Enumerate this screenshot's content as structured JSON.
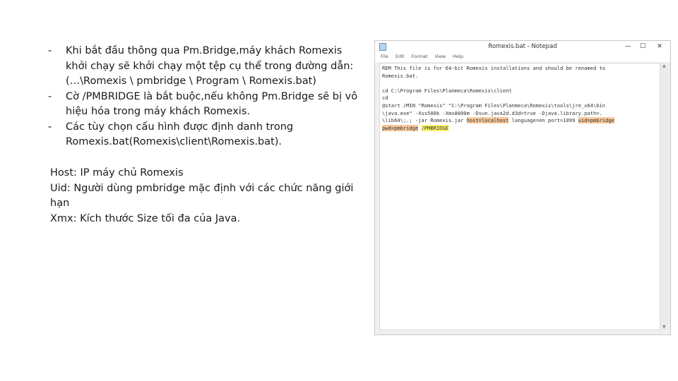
{
  "bullets": [
    {
      "dash": "-",
      "text": "Khi bắt đầu thông qua Pm.Bridge,máy khách Romexis khởi chạy sẽ khởi chạy một tệp cụ thể trong đường dẫn: (…\\Romexis \\ pmbridge \\ Program \\ Romexis.bat)"
    },
    {
      "dash": "-",
      "text": "Cờ /PMBRIDGE là bắt buộc,nếu không Pm.Bridge sẽ bị vô hiệu hóa trong máy khách Romexis."
    },
    {
      "dash": "-",
      "text": "Các tùy chọn cấu hình được định danh trong Romexis.bat(Romexis\\client\\Romexis.bat)."
    }
  ],
  "notes": [
    "Host: IP máy chủ Romexis",
    "Uid: Người dùng pmbridge mặc định với các chức năng giới hạn",
    "Xmx: Kích thước Size tối đa của Java."
  ],
  "notepad": {
    "title": "Romexis.bat - Notepad",
    "controls": {
      "minimize": "—",
      "maximize": "☐",
      "close": "✕"
    },
    "menu": [
      "File",
      "Edit",
      "Format",
      "View",
      "Help"
    ],
    "lines": {
      "l1": "REM This file is for 64-bit Romexis installations and should be renamed to",
      "l2": "Romexis.bat.",
      "l3": "",
      "l4": "cd C:\\Program Files\\Planmeca\\Romexis\\client",
      "l5": "cd",
      "l6": "@start /MIN \"Romexis\" \"C:\\Program Files\\Planmeca\\Romexis\\tools\\jre_x64\\bin",
      "l7": "\\java.exe\" -Xss500k -Xmx8000m -Dsun.java2d.d3d=true -Djava.library.path=.",
      "l8a": "\\lib64\\;.; -jar Romexis.jar ",
      "l8b": "host=localhost",
      "l8c": " language=en port=1099 ",
      "l8d": "uid=pmbridge",
      "l9a": "pwd=pmbridge",
      "l9b": " ",
      "l9c": "/PMBRIDGE"
    }
  },
  "colors": {
    "highlight_orange": "#f7c89b",
    "highlight_yellow": "#fff36b"
  }
}
